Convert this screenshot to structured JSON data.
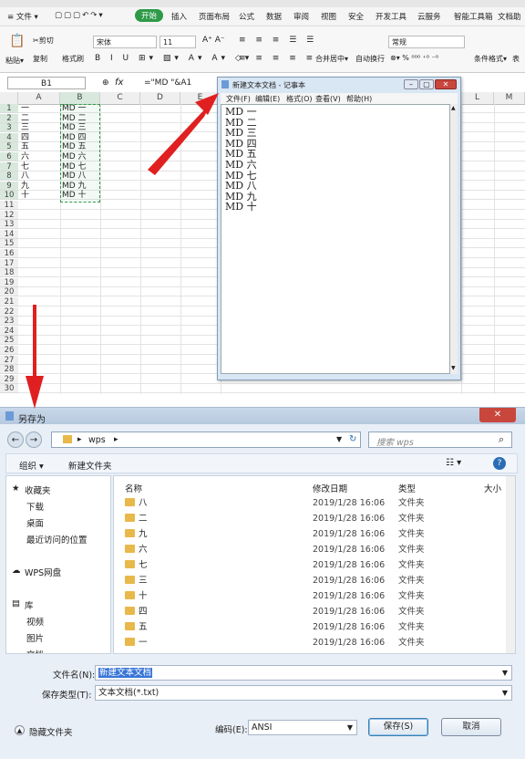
{
  "excel": {
    "menu": [
      "≡ 文件 ▾",
      "开始",
      "插入",
      "页面布局",
      "公式",
      "数据",
      "审阅",
      "视图",
      "安全",
      "开发工具",
      "云服务",
      "智能工具箱",
      "文档助"
    ],
    "ribbon": {
      "paste": "粘贴▾",
      "cut": "✂剪切",
      "copy": "复制",
      "format_painter": "格式刷",
      "font_name": "宋体",
      "font_size": "11",
      "merge": "合并居中▾",
      "wrap": "自动换行",
      "number_format": "常规",
      "cond_format": "条件格式▾",
      "table": "表"
    },
    "name_box": "B1",
    "fx": "fx",
    "formula": "=\"MD \"&A1",
    "columns": [
      "A",
      "B",
      "C",
      "D",
      "E",
      "L",
      "M"
    ],
    "rows": [
      "1",
      "2",
      "3",
      "4",
      "5",
      "6",
      "7",
      "8",
      "9",
      "10",
      "11",
      "12",
      "13",
      "14",
      "15",
      "16",
      "17",
      "18",
      "19",
      "20",
      "21",
      "22",
      "23",
      "24",
      "25",
      "26",
      "27",
      "28",
      "29",
      "30"
    ],
    "col_a": [
      "一",
      "二",
      "三",
      "四",
      "五",
      "六",
      "七",
      "八",
      "九",
      "十"
    ],
    "col_b": [
      "MD 一",
      "MD 二",
      "MD 三",
      "MD 四",
      "MD 五",
      "MD 六",
      "MD 七",
      "MD 八",
      "MD 九",
      "MD 十"
    ]
  },
  "notepad": {
    "title": "新建文本文档 - 记事本",
    "menu": [
      "文件(F)",
      "编辑(E)",
      "格式(O)",
      "查看(V)",
      "帮助(H)"
    ],
    "lines": [
      "MD 一",
      "MD 二",
      "MD 三",
      "MD 四",
      "MD 五",
      "MD 六",
      "MD 七",
      "MD 八",
      "MD 九",
      "MD 十"
    ]
  },
  "dialog": {
    "title": "另存为",
    "close": "✕",
    "breadcrumb": [
      "wps"
    ],
    "search_placeholder": "搜索 wps",
    "organize": "组织 ▾",
    "new_folder": "新建文件夹",
    "nav": [
      "收藏夹",
      "下载",
      "桌面",
      "最近访问的位置",
      "WPS网盘",
      "库",
      "视频",
      "图片",
      "文档"
    ],
    "headers": {
      "name": "名称",
      "date": "修改日期",
      "type": "类型",
      "size": "大小"
    },
    "files": [
      {
        "name": "八",
        "date": "2019/1/28 16:06",
        "type": "文件夹"
      },
      {
        "name": "二",
        "date": "2019/1/28 16:06",
        "type": "文件夹"
      },
      {
        "name": "九",
        "date": "2019/1/28 16:06",
        "type": "文件夹"
      },
      {
        "name": "六",
        "date": "2019/1/28 16:06",
        "type": "文件夹"
      },
      {
        "name": "七",
        "date": "2019/1/28 16:06",
        "type": "文件夹"
      },
      {
        "name": "三",
        "date": "2019/1/28 16:06",
        "type": "文件夹"
      },
      {
        "name": "十",
        "date": "2019/1/28 16:06",
        "type": "文件夹"
      },
      {
        "name": "四",
        "date": "2019/1/28 16:06",
        "type": "文件夹"
      },
      {
        "name": "五",
        "date": "2019/1/28 16:06",
        "type": "文件夹"
      },
      {
        "name": "一",
        "date": "2019/1/28 16:06",
        "type": "文件夹"
      }
    ],
    "filename_label": "文件名(N):",
    "filename_value": "新建文本文档",
    "filetype_label": "保存类型(T):",
    "filetype_value": "文本文档(*.txt)",
    "hide_folders": "隐藏文件夹",
    "encoding_label": "编码(E):",
    "encoding_value": "ANSI",
    "save": "保存(S)",
    "cancel": "取消"
  },
  "colors": {
    "accent_green": "#2e9a48",
    "arrow_red": "#e02020",
    "close_red": "#c9463d"
  }
}
